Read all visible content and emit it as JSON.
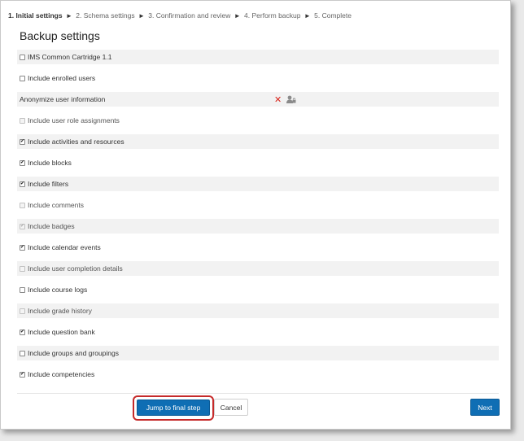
{
  "breadcrumb": {
    "steps": [
      "1. Initial settings",
      "2. Schema settings",
      "3. Confirmation and review",
      "4. Perform backup",
      "5. Complete"
    ],
    "separator": "►"
  },
  "page_title": "Backup settings",
  "settings": [
    {
      "label": "IMS Common Cartridge 1.1",
      "checked": false,
      "disabled": false
    },
    {
      "label": "Include enrolled users",
      "checked": false,
      "disabled": false
    },
    {
      "label": "Anonymize user information",
      "checked": false,
      "disabled": false
    },
    {
      "label": "Include user role assignments",
      "checked": false,
      "disabled": true
    },
    {
      "label": "Include activities and resources",
      "checked": true,
      "disabled": false
    },
    {
      "label": "Include blocks",
      "checked": true,
      "disabled": false
    },
    {
      "label": "Include filters",
      "checked": true,
      "disabled": false
    },
    {
      "label": "Include comments",
      "checked": false,
      "disabled": true
    },
    {
      "label": "Include badges",
      "checked": true,
      "disabled": true
    },
    {
      "label": "Include calendar events",
      "checked": true,
      "disabled": false
    },
    {
      "label": "Include user completion details",
      "checked": false,
      "disabled": true
    },
    {
      "label": "Include course logs",
      "checked": false,
      "disabled": false
    },
    {
      "label": "Include grade history",
      "checked": false,
      "disabled": true
    },
    {
      "label": "Include question bank",
      "checked": true,
      "disabled": false
    },
    {
      "label": "Include groups and groupings",
      "checked": false,
      "disabled": false
    },
    {
      "label": "Include competencies",
      "checked": true,
      "disabled": false
    }
  ],
  "anonymize_icons": [
    "close-x-icon",
    "user-lock-icon"
  ],
  "buttons": {
    "jump": "Jump to final step",
    "cancel": "Cancel",
    "next": "Next"
  },
  "colors": {
    "primary": "#0f6eb4",
    "highlight": "#c62a2a",
    "x_icon": "#d9251c",
    "row_shade": "#f2f2f2"
  }
}
